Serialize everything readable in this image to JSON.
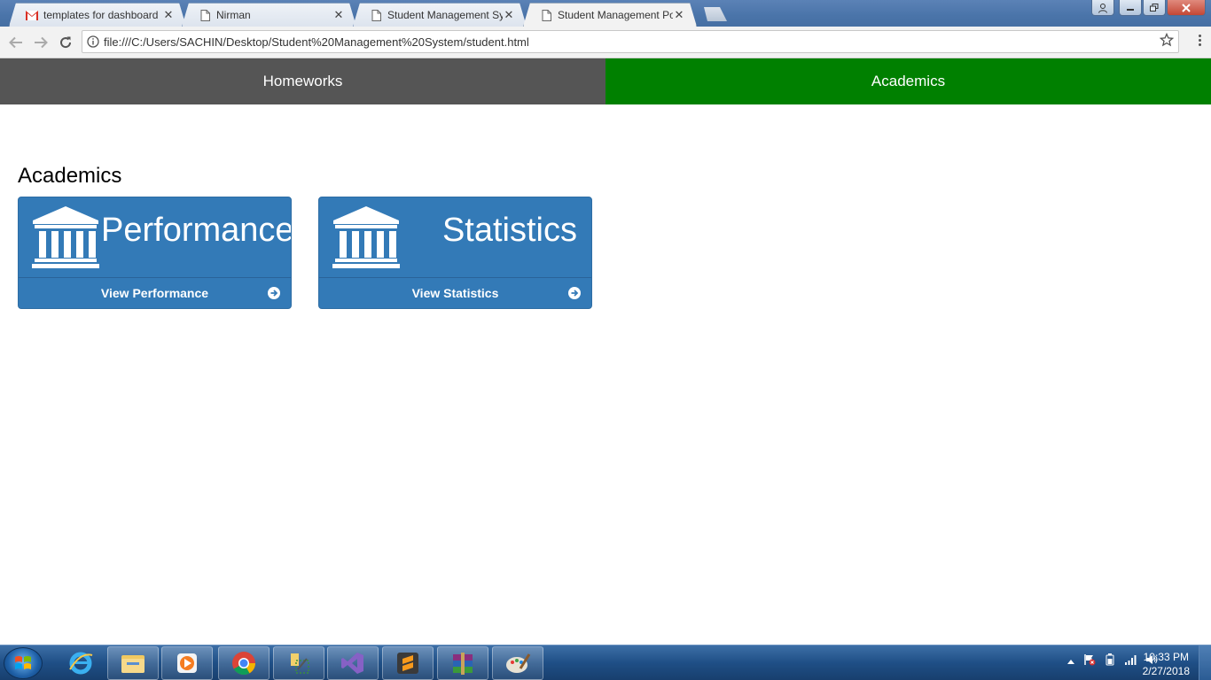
{
  "browser": {
    "tabs": [
      {
        "title": "templates for dashboard",
        "favicon": "gmail-icon",
        "active": false
      },
      {
        "title": "Nirman",
        "favicon": "page-icon",
        "active": false
      },
      {
        "title": "Student Management Sy",
        "favicon": "page-icon",
        "active": false
      },
      {
        "title": "Student Management Po",
        "favicon": "page-icon",
        "active": true
      }
    ],
    "close_glyph": "✕",
    "url": "file:///C:/Users/SACHIN/Desktop/Student%20Management%20System/student.html"
  },
  "page": {
    "nav": [
      {
        "label": "Homeworks",
        "color": "#555555"
      },
      {
        "label": "Academics",
        "color": "#008000",
        "active": true
      }
    ],
    "section_title": "Academics",
    "cards": [
      {
        "heading": "Performance",
        "link": "View Performance",
        "icon": "bank-icon"
      },
      {
        "heading": "Statistics",
        "link": "View Statistics",
        "icon": "bank-icon"
      }
    ],
    "card_color": "#337ab7"
  },
  "taskbar": {
    "pinned": [
      "internet-explorer-icon",
      "file-explorer-icon",
      "media-player-icon",
      "chrome-icon",
      "snipping-tool-icon",
      "visual-studio-icon",
      "sublime-text-icon",
      "winrar-icon",
      "paint-icon"
    ],
    "clock_time": "10:33 PM",
    "clock_date": "2/27/2018"
  }
}
